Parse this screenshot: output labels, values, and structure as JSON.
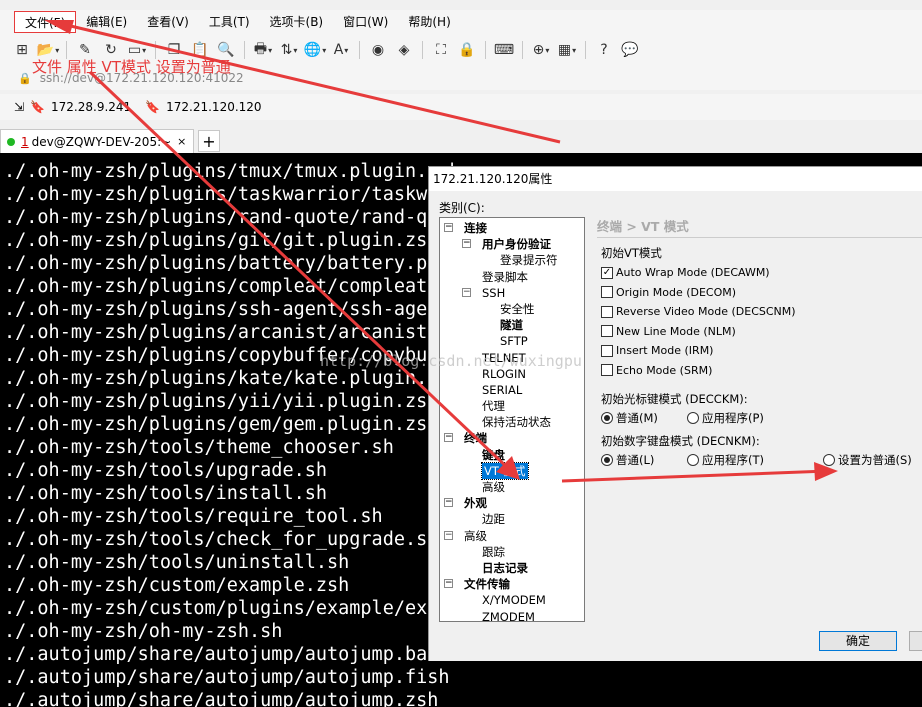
{
  "menubar": {
    "items": [
      "文件(F)",
      "编辑(E)",
      "查看(V)",
      "工具(T)",
      "选项卡(B)",
      "窗口(W)",
      "帮助(H)"
    ]
  },
  "annotation": {
    "text": "文件  属性  VT模式 设置为普通"
  },
  "address": {
    "text": "ssh://dev@172.21.120.120:41022"
  },
  "links": {
    "items": [
      "172.28.9.241",
      "172.21.120.120"
    ]
  },
  "tabs": {
    "number": "1",
    "title": " dev@ZQWY-DEV-205:~",
    "new_tab": "+"
  },
  "terminal": {
    "lines": [
      "./.oh-my-zsh/plugins/tmux/tmux.plugin.zsh",
      "./.oh-my-zsh/plugins/taskwarrior/taskwa",
      "./.oh-my-zsh/plugins/rand-quote/rand-qu",
      "./.oh-my-zsh/plugins/git/git.plugin.zsh",
      "./.oh-my-zsh/plugins/battery/battery.pl",
      "./.oh-my-zsh/plugins/compleat/compleat.",
      "./.oh-my-zsh/plugins/ssh-agent/ssh-agen",
      "./.oh-my-zsh/plugins/arcanist/arcanist.",
      "./.oh-my-zsh/plugins/copybuffer/copybuf",
      "./.oh-my-zsh/plugins/kate/kate.plugin.z",
      "./.oh-my-zsh/plugins/yii/yii.plugin.zsh",
      "./.oh-my-zsh/plugins/gem/gem.plugin.zsh",
      "./.oh-my-zsh/tools/theme_chooser.sh",
      "./.oh-my-zsh/tools/upgrade.sh",
      "./.oh-my-zsh/tools/install.sh",
      "./.oh-my-zsh/tools/require_tool.sh",
      "./.oh-my-zsh/tools/check_for_upgrade.sh",
      "./.oh-my-zsh/tools/uninstall.sh",
      "./.oh-my-zsh/custom/example.zsh",
      "./.oh-my-zsh/custom/plugins/example/exa",
      "./.oh-my-zsh/oh-my-zsh.sh",
      "./.autojump/share/autojump/autojump.bas",
      "./.autojump/share/autojump/autojump.fish",
      "./.autojump/share/autojump/autojump.zsh"
    ]
  },
  "dialog": {
    "title": "172.21.120.120属性",
    "category_label": "类别(C):",
    "tree": [
      {
        "label": "连接",
        "level": 0,
        "bold": true,
        "expander": "minus"
      },
      {
        "label": "用户身份验证",
        "level": 1,
        "bold": true,
        "expander": "minus"
      },
      {
        "label": "登录提示符",
        "level": 2
      },
      {
        "label": "登录脚本",
        "level": 1
      },
      {
        "label": "SSH",
        "level": 1,
        "expander": "minus"
      },
      {
        "label": "安全性",
        "level": 2
      },
      {
        "label": "隧道",
        "level": 2,
        "bold": true
      },
      {
        "label": "SFTP",
        "level": 2
      },
      {
        "label": "TELNET",
        "level": 1
      },
      {
        "label": "RLOGIN",
        "level": 1
      },
      {
        "label": "SERIAL",
        "level": 1
      },
      {
        "label": "代理",
        "level": 1
      },
      {
        "label": "保持活动状态",
        "level": 1
      },
      {
        "label": "终端",
        "level": 0,
        "bold": true,
        "expander": "minus"
      },
      {
        "label": "键盘",
        "level": 1,
        "bold": true
      },
      {
        "label": "VT 模式",
        "level": 1,
        "selected": true
      },
      {
        "label": "高级",
        "level": 1
      },
      {
        "label": "外观",
        "level": 0,
        "bold": true,
        "expander": "minus"
      },
      {
        "label": "边距",
        "level": 1
      },
      {
        "label": "高级",
        "level": 0,
        "expander": "minus"
      },
      {
        "label": "跟踪",
        "level": 1
      },
      {
        "label": "日志记录",
        "level": 1,
        "bold": true
      },
      {
        "label": "文件传输",
        "level": 0,
        "bold": true,
        "expander": "minus"
      },
      {
        "label": "X/YMODEM",
        "level": 1
      },
      {
        "label": "ZMODEM",
        "level": 1
      }
    ],
    "pane_title": "终端 > VT 模式",
    "init_vt_label": "初始VT模式",
    "checkboxes": [
      {
        "label": "Auto Wrap Mode (DECAWM)",
        "checked": true
      },
      {
        "label": "Origin Mode (DECOM)",
        "checked": false
      },
      {
        "label": "Reverse Video Mode (DECSCNM)",
        "checked": false
      },
      {
        "label": "New Line Mode (NLM)",
        "checked": false
      },
      {
        "label": "Insert Mode (IRM)",
        "checked": false
      },
      {
        "label": "Echo Mode (SRM)",
        "checked": false
      }
    ],
    "cursor_label": "初始光标键模式 (DECCKM):",
    "cursor_options": [
      {
        "label": "普通(M)",
        "checked": true
      },
      {
        "label": "应用程序(P)",
        "checked": false
      }
    ],
    "numpad_label": "初始数字键盘模式 (DECNKM):",
    "numpad_options": [
      {
        "label": "普通(L)",
        "checked": true
      },
      {
        "label": "应用程序(T)",
        "checked": false
      },
      {
        "label": "设置为普通(S)",
        "checked": false
      }
    ],
    "ok_label": "确定"
  },
  "watermark": "http://blog.csdn.net/wuxingpu",
  "colors": {
    "annotation": "#e63b3b",
    "selection": "#0078d7",
    "tab_status": "#1fb823"
  }
}
